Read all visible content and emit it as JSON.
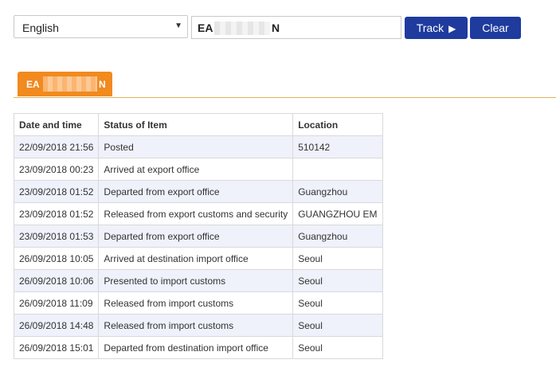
{
  "toolbar": {
    "language_value": "English",
    "language_caret": "▼",
    "tracking_number_prefix": "EA",
    "tracking_number_suffix": "N",
    "track_label": "Track",
    "track_icon": "▶",
    "clear_label": "Clear"
  },
  "tab": {
    "label_prefix": "EA",
    "label_suffix": "N",
    "color": "#f18a1f"
  },
  "table": {
    "headers": [
      "Date and time",
      "Status of Item",
      "Location"
    ],
    "rows": [
      {
        "date": "22/09/2018 21:56",
        "status": "Posted",
        "location": "510142"
      },
      {
        "date": "23/09/2018 00:23",
        "status": "Arrived at export office",
        "location": ""
      },
      {
        "date": "23/09/2018 01:52",
        "status": "Departed from export office",
        "location": "Guangzhou"
      },
      {
        "date": "23/09/2018 01:52",
        "status": "Released from export customs and security",
        "location": "GUANGZHOU EM"
      },
      {
        "date": "23/09/2018 01:53",
        "status": "Departed from export office",
        "location": "Guangzhou"
      },
      {
        "date": "26/09/2018 10:05",
        "status": "Arrived at destination import office",
        "location": "Seoul"
      },
      {
        "date": "26/09/2018 10:06",
        "status": "Presented to import customs",
        "location": "Seoul"
      },
      {
        "date": "26/09/2018 11:09",
        "status": "Released from import customs",
        "location": "Seoul"
      },
      {
        "date": "26/09/2018 14:48",
        "status": "Released from import customs",
        "location": "Seoul"
      },
      {
        "date": "26/09/2018 15:01",
        "status": "Departed from destination import office",
        "location": "Seoul"
      }
    ]
  },
  "colors": {
    "button_bg": "#1f3b9e",
    "tab_bg": "#f18a1f",
    "row_stripe": "#eff1fb"
  }
}
